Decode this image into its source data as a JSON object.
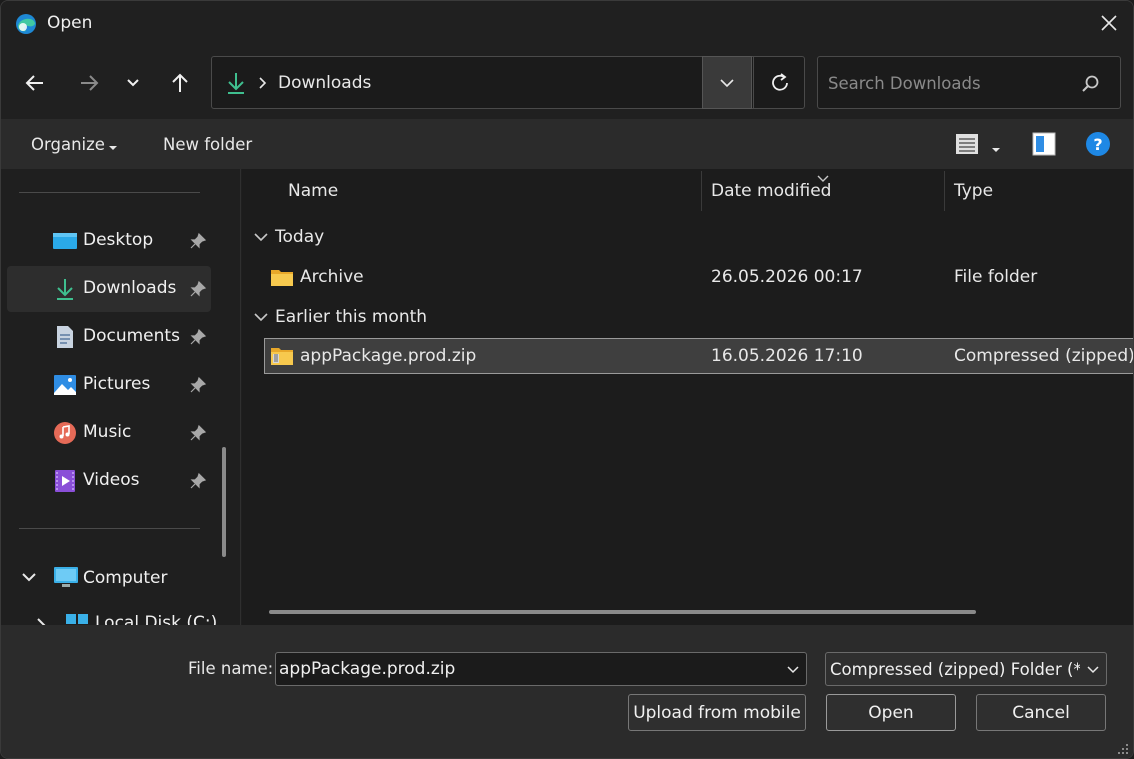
{
  "window": {
    "title": "Open"
  },
  "address": {
    "current_folder": "Downloads"
  },
  "search": {
    "placeholder": "Search Downloads"
  },
  "toolbar": {
    "organize_label": "Organize",
    "new_folder_label": "New folder"
  },
  "sidebar": {
    "quick_access": [
      {
        "label": "Desktop",
        "icon": "desktop-icon",
        "pinned": true
      },
      {
        "label": "Downloads",
        "icon": "download-icon",
        "pinned": true,
        "selected": true
      },
      {
        "label": "Documents",
        "icon": "documents-icon",
        "pinned": true
      },
      {
        "label": "Pictures",
        "icon": "pictures-icon",
        "pinned": true
      },
      {
        "label": "Music",
        "icon": "music-icon",
        "pinned": true
      },
      {
        "label": "Videos",
        "icon": "videos-icon",
        "pinned": true
      }
    ],
    "computer": {
      "label": "Computer",
      "expanded": true
    },
    "local_disk": {
      "label": "Local Disk (C:)"
    }
  },
  "columns": {
    "name": "Name",
    "date_modified": "Date modified",
    "type": "Type"
  },
  "groups": [
    {
      "label": "Today",
      "files": [
        {
          "name": "Archive",
          "date": "26.05.2026 00:17",
          "type": "File folder",
          "icon": "folder-icon"
        }
      ]
    },
    {
      "label": "Earlier this month",
      "files": [
        {
          "name": "appPackage.prod.zip",
          "date": "16.05.2026 17:10",
          "type": "Compressed (zipped)...",
          "icon": "zip-folder-icon",
          "selected": true
        }
      ]
    }
  ],
  "footer": {
    "file_name_label": "File name:",
    "file_name_value": "appPackage.prod.zip",
    "filter_value": "Compressed (zipped) Folder (*.zip)",
    "upload_mobile_label": "Upload from mobile",
    "open_label": "Open",
    "cancel_label": "Cancel"
  },
  "colors": {
    "accent": "#0078d4",
    "folder": "#f2c14e",
    "download_green": "#3fbf8f",
    "background": "#1c1c1c"
  }
}
